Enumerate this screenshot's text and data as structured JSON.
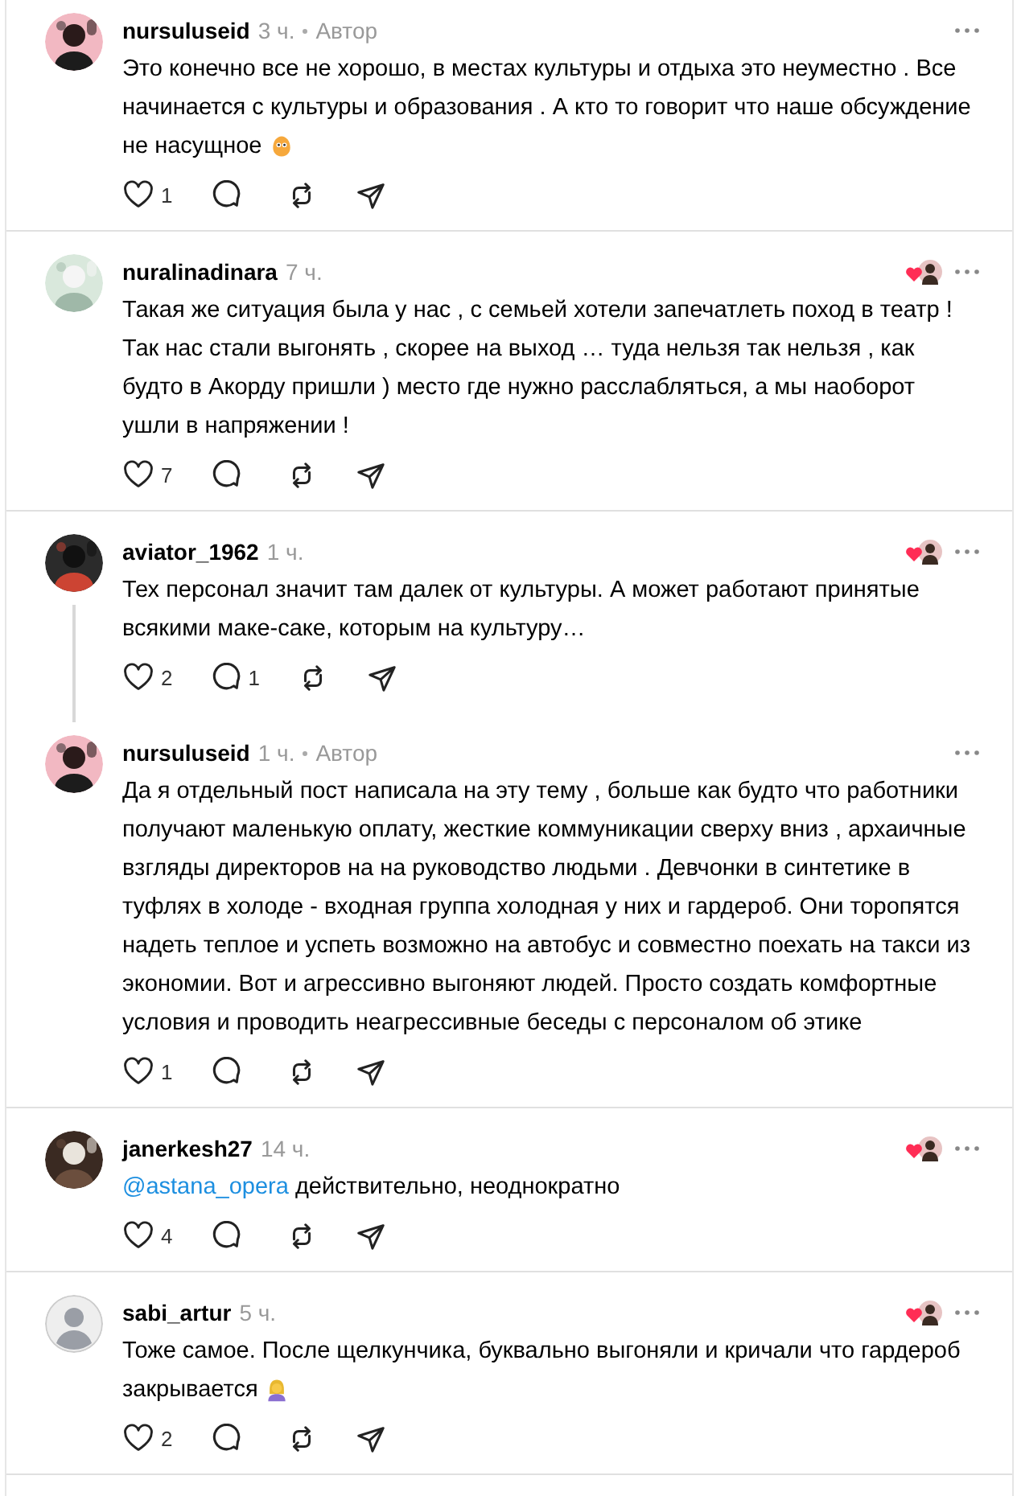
{
  "posts": [
    {
      "username": "nursuluseid",
      "time": "3 ч.",
      "author_badge": "Автор",
      "liked_by_author": false,
      "text": "Это конечно все не хорошо, в местах культуры и отдыха это неуместно . Все начинается с культуры и образования . А кто то говорит что наше обсуждение не насущное",
      "emoji": {
        "kind": "hugging"
      },
      "likes": "1",
      "thread_continues": false
    },
    {
      "username": "nuralinadinara",
      "time": "7 ч.",
      "liked_by_author": true,
      "text": "Такая же ситуация была у нас , с семьей хотели запечатлеть поход в театр ! Так нас стали выгонять , скорее на выход … туда нельзя так нельзя , как будто в Акорду пришли ) место где нужно расслабляться, а мы наоборот ушли в напряжении !",
      "likes": "7",
      "thread_continues": false
    },
    {
      "username": "aviator_1962",
      "time": "1 ч.",
      "liked_by_author": true,
      "text": "Тех персонал значит там далек от культуры. А может работают принятые всякими маке-саке, которым на культуру…",
      "likes": "2",
      "replies": "1",
      "thread_continues": true
    },
    {
      "username": "nursuluseid",
      "time": "1 ч.",
      "author_badge": "Автор",
      "liked_by_author": false,
      "text": "Да я отдельный пост написала на эту тему , больше как будто что работники получают маленькую оплату, жесткие коммуникации сверху вниз , архаичные взгляды директоров на на руководство людьми . Девчонки в синтетике в туфлях в холоде - входная группа холодная у них и гардероб. Они торопятся надеть теплое и успеть возможно на автобус и совместно поехать на такси из экономии. Вот и агрессивно выгоняют людей. Просто создать комфортные условия и проводить неагрессивные беседы с персоналом об этике",
      "likes": "1",
      "thread_continues": false
    },
    {
      "username": "janerkesh27",
      "time": "14 ч.",
      "liked_by_author": true,
      "mention": "@astana_opera",
      "text": "действительно, неоднократно",
      "likes": "4",
      "thread_continues": false
    },
    {
      "username": "sabi_artur",
      "time": "5 ч.",
      "avatar": {
        "kind": "default"
      },
      "liked_by_author": true,
      "text": "Тоже самое. После щелкунчика, буквально выгоняли и кричали что гардероб закрывается",
      "emoji": {
        "kind": "woman"
      },
      "likes": "2",
      "thread_continues": false
    }
  ]
}
